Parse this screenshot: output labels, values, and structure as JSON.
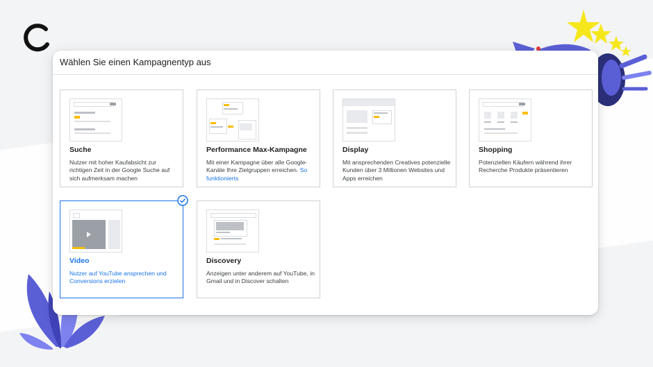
{
  "dialog": {
    "title": "Wählen Sie einen Kampagnentyp aus"
  },
  "campaign_types": [
    {
      "id": "search",
      "title": "Suche",
      "description": "Nutzer mit hoher Kaufabsicht zur richtigen Zeit in der Google Suche auf sich aufmerksam machen",
      "selected": false
    },
    {
      "id": "pmax",
      "title": "Performance Max-Kampagne",
      "description": "Mit einer Kampagne über alle Google-Kanäle Ihre Zielgruppen erreichen.",
      "link": "So funktionierts",
      "selected": false
    },
    {
      "id": "display",
      "title": "Display",
      "description": "Mit ansprechenden Creatives potenzielle Kunden über 3 Millionen Websites und Apps erreichen",
      "selected": false
    },
    {
      "id": "shopping",
      "title": "Shopping",
      "description": "Potenziellen Käufern während ihrer Recherche Produkte präsentieren",
      "selected": false
    },
    {
      "id": "video",
      "title": "Video",
      "description": "Nutzer auf YouTube ansprechen und Conversions erzielen",
      "selected": true
    },
    {
      "id": "discovery",
      "title": "Discovery",
      "description": "Anzeigen unter anderem auf YouTube, in Gmail und in Discover schalten",
      "selected": false
    }
  ],
  "colors": {
    "accent": "#1a73e8",
    "highlight": "#fbbc04",
    "decoration": "#5b5fd6",
    "star": "#f6e71c"
  }
}
